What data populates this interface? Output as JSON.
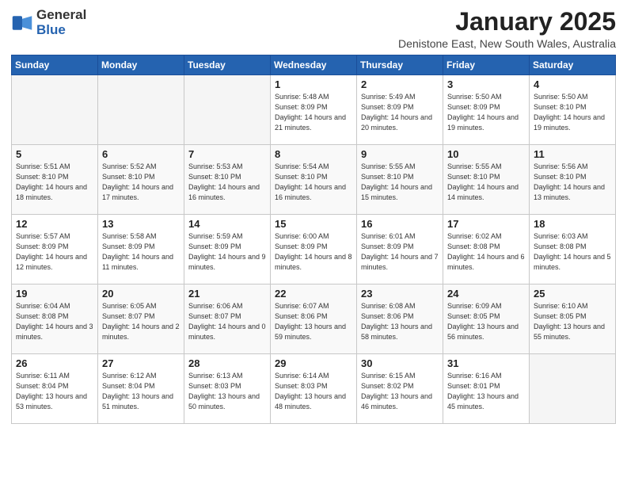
{
  "logo": {
    "general": "General",
    "blue": "Blue"
  },
  "calendar": {
    "title": "January 2025",
    "subtitle": "Denistone East, New South Wales, Australia"
  },
  "weekdays": [
    "Sunday",
    "Monday",
    "Tuesday",
    "Wednesday",
    "Thursday",
    "Friday",
    "Saturday"
  ],
  "weeks": [
    [
      {
        "day": "",
        "sunrise": "",
        "sunset": "",
        "daylight": "",
        "empty": true
      },
      {
        "day": "",
        "sunrise": "",
        "sunset": "",
        "daylight": "",
        "empty": true
      },
      {
        "day": "",
        "sunrise": "",
        "sunset": "",
        "daylight": "",
        "empty": true
      },
      {
        "day": "1",
        "sunrise": "Sunrise: 5:48 AM",
        "sunset": "Sunset: 8:09 PM",
        "daylight": "Daylight: 14 hours and 21 minutes.",
        "empty": false
      },
      {
        "day": "2",
        "sunrise": "Sunrise: 5:49 AM",
        "sunset": "Sunset: 8:09 PM",
        "daylight": "Daylight: 14 hours and 20 minutes.",
        "empty": false
      },
      {
        "day": "3",
        "sunrise": "Sunrise: 5:50 AM",
        "sunset": "Sunset: 8:09 PM",
        "daylight": "Daylight: 14 hours and 19 minutes.",
        "empty": false
      },
      {
        "day": "4",
        "sunrise": "Sunrise: 5:50 AM",
        "sunset": "Sunset: 8:10 PM",
        "daylight": "Daylight: 14 hours and 19 minutes.",
        "empty": false
      }
    ],
    [
      {
        "day": "5",
        "sunrise": "Sunrise: 5:51 AM",
        "sunset": "Sunset: 8:10 PM",
        "daylight": "Daylight: 14 hours and 18 minutes.",
        "empty": false
      },
      {
        "day": "6",
        "sunrise": "Sunrise: 5:52 AM",
        "sunset": "Sunset: 8:10 PM",
        "daylight": "Daylight: 14 hours and 17 minutes.",
        "empty": false
      },
      {
        "day": "7",
        "sunrise": "Sunrise: 5:53 AM",
        "sunset": "Sunset: 8:10 PM",
        "daylight": "Daylight: 14 hours and 16 minutes.",
        "empty": false
      },
      {
        "day": "8",
        "sunrise": "Sunrise: 5:54 AM",
        "sunset": "Sunset: 8:10 PM",
        "daylight": "Daylight: 14 hours and 16 minutes.",
        "empty": false
      },
      {
        "day": "9",
        "sunrise": "Sunrise: 5:55 AM",
        "sunset": "Sunset: 8:10 PM",
        "daylight": "Daylight: 14 hours and 15 minutes.",
        "empty": false
      },
      {
        "day": "10",
        "sunrise": "Sunrise: 5:55 AM",
        "sunset": "Sunset: 8:10 PM",
        "daylight": "Daylight: 14 hours and 14 minutes.",
        "empty": false
      },
      {
        "day": "11",
        "sunrise": "Sunrise: 5:56 AM",
        "sunset": "Sunset: 8:10 PM",
        "daylight": "Daylight: 14 hours and 13 minutes.",
        "empty": false
      }
    ],
    [
      {
        "day": "12",
        "sunrise": "Sunrise: 5:57 AM",
        "sunset": "Sunset: 8:09 PM",
        "daylight": "Daylight: 14 hours and 12 minutes.",
        "empty": false
      },
      {
        "day": "13",
        "sunrise": "Sunrise: 5:58 AM",
        "sunset": "Sunset: 8:09 PM",
        "daylight": "Daylight: 14 hours and 11 minutes.",
        "empty": false
      },
      {
        "day": "14",
        "sunrise": "Sunrise: 5:59 AM",
        "sunset": "Sunset: 8:09 PM",
        "daylight": "Daylight: 14 hours and 9 minutes.",
        "empty": false
      },
      {
        "day": "15",
        "sunrise": "Sunrise: 6:00 AM",
        "sunset": "Sunset: 8:09 PM",
        "daylight": "Daylight: 14 hours and 8 minutes.",
        "empty": false
      },
      {
        "day": "16",
        "sunrise": "Sunrise: 6:01 AM",
        "sunset": "Sunset: 8:09 PM",
        "daylight": "Daylight: 14 hours and 7 minutes.",
        "empty": false
      },
      {
        "day": "17",
        "sunrise": "Sunrise: 6:02 AM",
        "sunset": "Sunset: 8:08 PM",
        "daylight": "Daylight: 14 hours and 6 minutes.",
        "empty": false
      },
      {
        "day": "18",
        "sunrise": "Sunrise: 6:03 AM",
        "sunset": "Sunset: 8:08 PM",
        "daylight": "Daylight: 14 hours and 5 minutes.",
        "empty": false
      }
    ],
    [
      {
        "day": "19",
        "sunrise": "Sunrise: 6:04 AM",
        "sunset": "Sunset: 8:08 PM",
        "daylight": "Daylight: 14 hours and 3 minutes.",
        "empty": false
      },
      {
        "day": "20",
        "sunrise": "Sunrise: 6:05 AM",
        "sunset": "Sunset: 8:07 PM",
        "daylight": "Daylight: 14 hours and 2 minutes.",
        "empty": false
      },
      {
        "day": "21",
        "sunrise": "Sunrise: 6:06 AM",
        "sunset": "Sunset: 8:07 PM",
        "daylight": "Daylight: 14 hours and 0 minutes.",
        "empty": false
      },
      {
        "day": "22",
        "sunrise": "Sunrise: 6:07 AM",
        "sunset": "Sunset: 8:06 PM",
        "daylight": "Daylight: 13 hours and 59 minutes.",
        "empty": false
      },
      {
        "day": "23",
        "sunrise": "Sunrise: 6:08 AM",
        "sunset": "Sunset: 8:06 PM",
        "daylight": "Daylight: 13 hours and 58 minutes.",
        "empty": false
      },
      {
        "day": "24",
        "sunrise": "Sunrise: 6:09 AM",
        "sunset": "Sunset: 8:05 PM",
        "daylight": "Daylight: 13 hours and 56 minutes.",
        "empty": false
      },
      {
        "day": "25",
        "sunrise": "Sunrise: 6:10 AM",
        "sunset": "Sunset: 8:05 PM",
        "daylight": "Daylight: 13 hours and 55 minutes.",
        "empty": false
      }
    ],
    [
      {
        "day": "26",
        "sunrise": "Sunrise: 6:11 AM",
        "sunset": "Sunset: 8:04 PM",
        "daylight": "Daylight: 13 hours and 53 minutes.",
        "empty": false
      },
      {
        "day": "27",
        "sunrise": "Sunrise: 6:12 AM",
        "sunset": "Sunset: 8:04 PM",
        "daylight": "Daylight: 13 hours and 51 minutes.",
        "empty": false
      },
      {
        "day": "28",
        "sunrise": "Sunrise: 6:13 AM",
        "sunset": "Sunset: 8:03 PM",
        "daylight": "Daylight: 13 hours and 50 minutes.",
        "empty": false
      },
      {
        "day": "29",
        "sunrise": "Sunrise: 6:14 AM",
        "sunset": "Sunset: 8:03 PM",
        "daylight": "Daylight: 13 hours and 48 minutes.",
        "empty": false
      },
      {
        "day": "30",
        "sunrise": "Sunrise: 6:15 AM",
        "sunset": "Sunset: 8:02 PM",
        "daylight": "Daylight: 13 hours and 46 minutes.",
        "empty": false
      },
      {
        "day": "31",
        "sunrise": "Sunrise: 6:16 AM",
        "sunset": "Sunset: 8:01 PM",
        "daylight": "Daylight: 13 hours and 45 minutes.",
        "empty": false
      },
      {
        "day": "",
        "sunrise": "",
        "sunset": "",
        "daylight": "",
        "empty": true
      }
    ]
  ]
}
